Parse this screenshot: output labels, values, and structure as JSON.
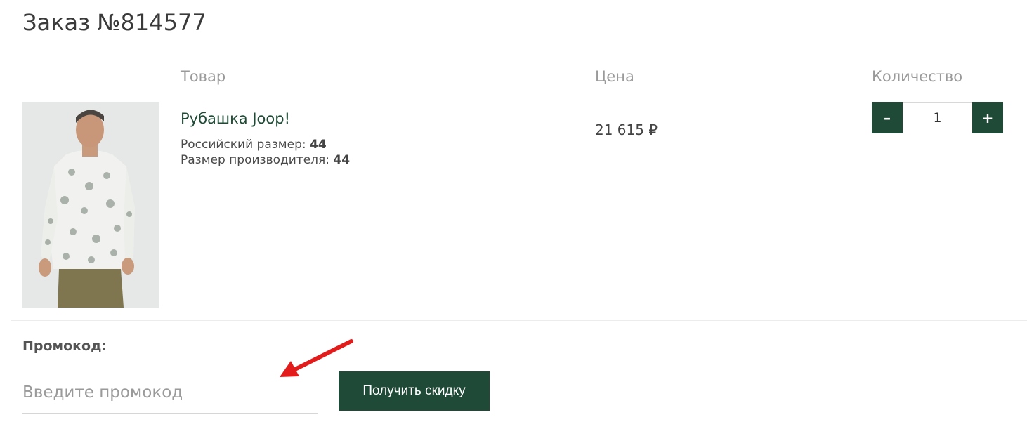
{
  "order": {
    "title": "Заказ №814577"
  },
  "columns": {
    "product": "Товар",
    "price": "Цена",
    "quantity": "Количество"
  },
  "item": {
    "name": "Рубашка Joop!",
    "russian_size_label": "Российский размер:",
    "russian_size_value": "44",
    "manufacturer_size_label": "Размер производителя:",
    "manufacturer_size_value": "44",
    "price": "21 615 ₽",
    "quantity": "1",
    "minus_label": "–",
    "plus_label": "+"
  },
  "promo": {
    "label": "Промокод:",
    "placeholder": "Введите промокод",
    "button_label": "Получить скидку"
  },
  "colors": {
    "accent": "#1f4a38",
    "arrow": "#e21b1b"
  }
}
